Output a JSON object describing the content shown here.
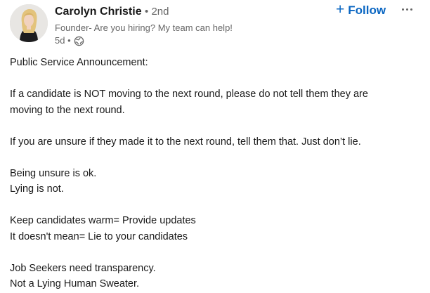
{
  "author": {
    "name": "Carolyn Christie",
    "degree": "• 2nd",
    "headline": "Founder- Are you hiring? My team can help!",
    "time": "5d •",
    "visibility_icon": "globe-icon"
  },
  "actions": {
    "follow_plus": "+",
    "follow_label": "Follow",
    "more_icon": "ellipsis-icon"
  },
  "post": {
    "lines": [
      "Public Service Announcement:",
      "",
      "If a candidate is NOT moving to the next round, please do not tell them they are",
      "moving to the next round.",
      "",
      "If you are unsure if they made it to the next round, tell them that. Just don’t lie.",
      "",
      "Being unsure is ok.",
      "Lying is not.",
      "",
      "Keep candidates warm= Provide updates",
      "It doesn't mean= Lie to your candidates",
      "",
      "Job Seekers need transparency.",
      "Not a Lying Human Sweater."
    ]
  },
  "colors": {
    "follow": "#0a66c2",
    "secondary_text": "#666666",
    "primary_text": "#191919"
  }
}
